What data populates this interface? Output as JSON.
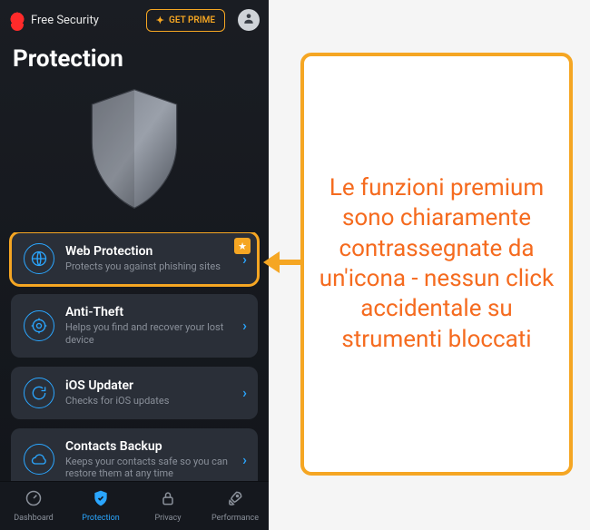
{
  "header": {
    "app_name": "Free Security",
    "prime_label": "GET PRIME"
  },
  "page_title": "Protection",
  "features": [
    {
      "title": "Web Protection",
      "subtitle": "Protects you against phishing sites",
      "premium": true,
      "highlight": true,
      "icon": "globe"
    },
    {
      "title": "Anti-Theft",
      "subtitle": "Helps you find and recover your lost device",
      "premium": false,
      "icon": "target"
    },
    {
      "title": "iOS Updater",
      "subtitle": "Checks for iOS updates",
      "premium": false,
      "icon": "refresh"
    },
    {
      "title": "Contacts Backup",
      "subtitle": "Keeps your contacts safe so you can restore them at any time",
      "premium": false,
      "icon": "cloud"
    }
  ],
  "nav": [
    {
      "label": "Dashboard",
      "active": false
    },
    {
      "label": "Protection",
      "active": true
    },
    {
      "label": "Privacy",
      "active": false
    },
    {
      "label": "Performance",
      "active": false
    }
  ],
  "callout": {
    "text": "Le funzioni premium sono chiaramente contrassegnate da un'icona - nessun click accidentale su strumenti bloccati"
  },
  "colors": {
    "accent_orange": "#f5a623",
    "accent_blue": "#2aa6ff",
    "text_orange": "#f56b1f"
  }
}
